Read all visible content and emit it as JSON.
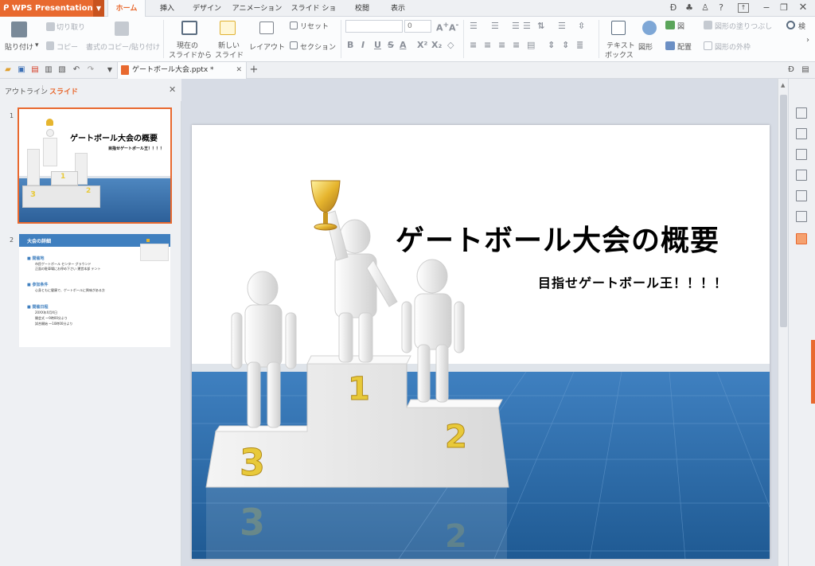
{
  "app": {
    "title": "WPS Presentation"
  },
  "menu": {
    "tabs": [
      "ホーム",
      "挿入",
      "デザイン",
      "アニメーション",
      "スライド ショー",
      "校閲",
      "表示"
    ]
  },
  "ribbon": {
    "paste": "貼り付け",
    "cut": "切り取り",
    "copy": "コピー",
    "format_copy": "書式のコピー/貼り付け",
    "from_current_1": "現在の",
    "from_current_2": "スライドから",
    "new_slide_1": "新しい",
    "new_slide_2": "スライド",
    "layout": "レイアウト",
    "reset": "リセット",
    "section": "セクション",
    "font_size": "0",
    "bold": "B",
    "italic": "I",
    "underline": "U",
    "strike": "S",
    "text_color": "A",
    "text_box_1": "テキスト",
    "text_box_2": "ボックス",
    "shape": "図形",
    "picture": "図",
    "arrange": "配置",
    "shape_fill": "図形の塗りつぶし",
    "shape_outline": "図形の外枠",
    "find": "検"
  },
  "document": {
    "tab_name": "ゲートボール大会.pptx *"
  },
  "pane": {
    "outline_tab": "アウトライン",
    "slides_tab": "スライド",
    "slides": [
      {
        "num": "1",
        "title": "ゲートボール大会の概要",
        "subtitle": "目指せゲートボール王！！！！"
      },
      {
        "num": "2",
        "title": "大会の詳細",
        "items": [
          {
            "head": "開催地",
            "lines": [
              "市民ゲートボール センター グラウンド",
              "正面の駐車場にお停め下さい 運営本部 テント"
            ]
          },
          {
            "head": "参加条件",
            "lines": [
              "心身ともに健康で、ゲートボールに興味がある方"
            ]
          },
          {
            "head": "開催日程",
            "lines": [
              "20XX年X月X日",
              "開会式 ～9時00分より",
              "試合開始 ～10時00分より"
            ]
          }
        ]
      }
    ]
  },
  "slide": {
    "title": "ゲートボール大会の概要",
    "subtitle": "目指せゲートボール王！！！！",
    "podium_1": "1",
    "podium_2": "2",
    "podium_3": "3"
  },
  "colors": {
    "accent": "#e8692f",
    "floor": "#2d6faa",
    "gold": "#e8c93a"
  }
}
